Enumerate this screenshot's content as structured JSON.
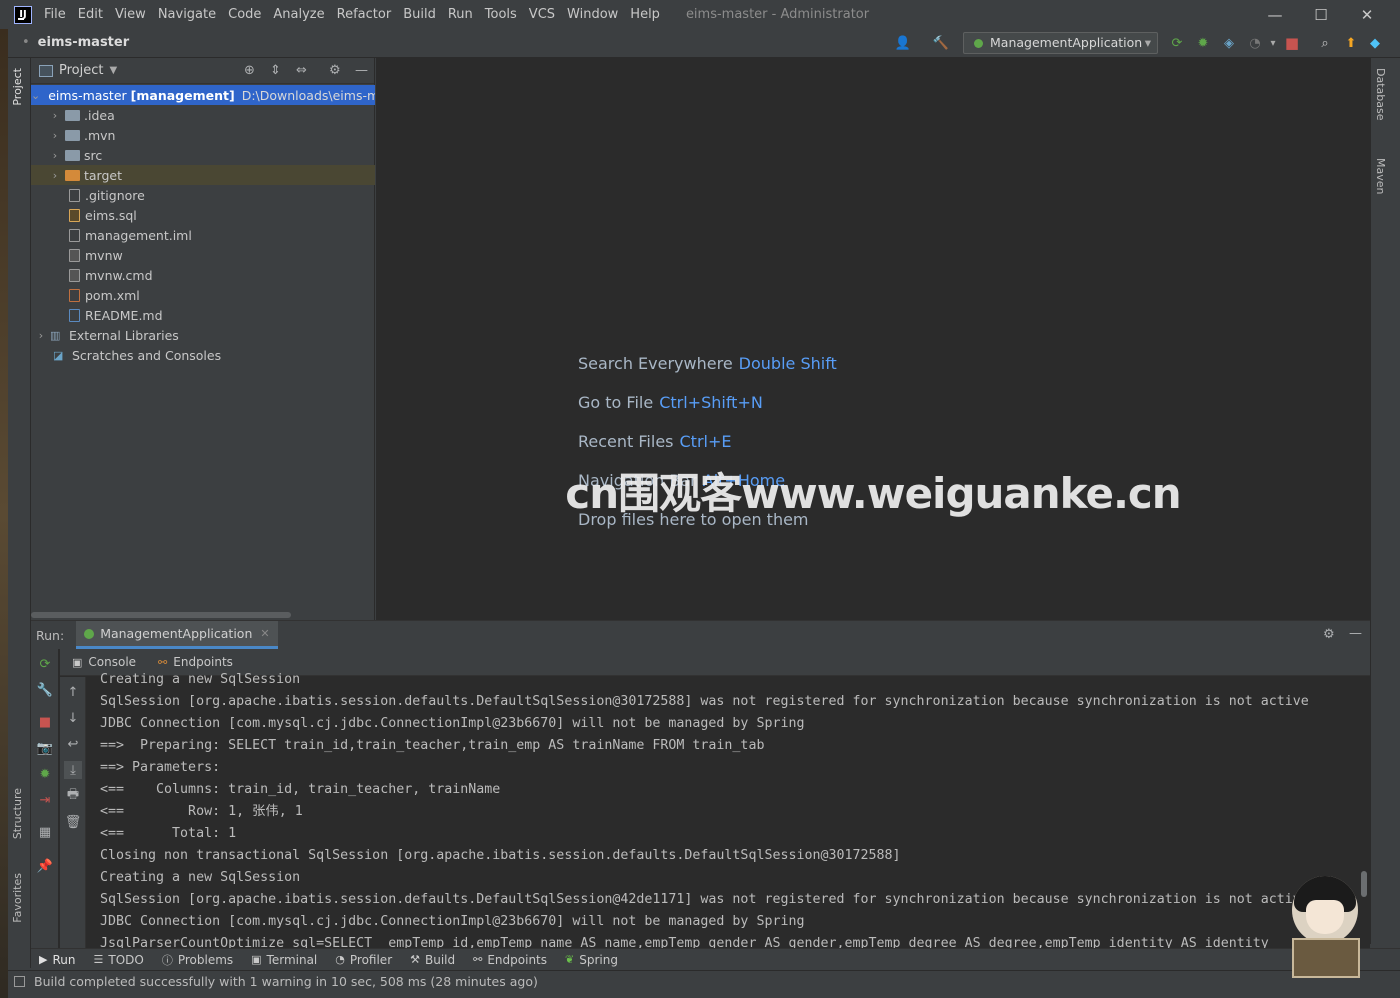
{
  "window": {
    "title": "eims-master - Administrator",
    "logo_text": "IJ",
    "minimize": "—",
    "maximize": "☐",
    "close": "✕"
  },
  "menu": [
    "File",
    "Edit",
    "View",
    "Navigate",
    "Code",
    "Analyze",
    "Refactor",
    "Build",
    "Run",
    "Tools",
    "VCS",
    "Window",
    "Help"
  ],
  "navbar": {
    "breadcrumb": "eims-master",
    "run_configuration": "ManagementApplication"
  },
  "left_strip": {
    "project_tab": "Project",
    "structure_tab": "Structure",
    "favorites_tab": "Favorites"
  },
  "right_strip": {
    "database_tab": "Database",
    "maven_tab": "Maven"
  },
  "project": {
    "title": "Project",
    "root": {
      "name": "eims-master",
      "module": "[management]",
      "path": "D:\\Downloads\\eims-m"
    },
    "items": [
      {
        "name": ".idea",
        "kind": "folder"
      },
      {
        "name": ".mvn",
        "kind": "folder"
      },
      {
        "name": "src",
        "kind": "folder"
      },
      {
        "name": "target",
        "kind": "folder-excluded"
      },
      {
        "name": ".gitignore",
        "kind": "file"
      },
      {
        "name": "eims.sql",
        "kind": "file"
      },
      {
        "name": "management.iml",
        "kind": "file"
      },
      {
        "name": "mvnw",
        "kind": "file"
      },
      {
        "name": "mvnw.cmd",
        "kind": "file"
      },
      {
        "name": "pom.xml",
        "kind": "file"
      },
      {
        "name": "README.md",
        "kind": "file"
      }
    ],
    "external_libraries": "External Libraries",
    "scratches": "Scratches and Consoles"
  },
  "editor": {
    "hints": [
      {
        "label": "Search Everywhere",
        "key": "Double Shift"
      },
      {
        "label": "Go to File",
        "key": "Ctrl+Shift+N"
      },
      {
        "label": "Recent Files",
        "key": "Ctrl+E"
      },
      {
        "label": "Navigation Bar",
        "key": "Alt+Home"
      },
      {
        "label": "Drop files here to open them",
        "key": ""
      }
    ],
    "watermark": "cn围观客www.weiguanke.cn"
  },
  "run": {
    "label": "Run:",
    "tab": "ManagementApplication",
    "console_tab": "Console",
    "endpoints_tab": "Endpoints",
    "lines": [
      "Creating a new SqlSession",
      "SqlSession [org.apache.ibatis.session.defaults.DefaultSqlSession@30172588] was not registered for synchronization because synchronization is not active",
      "JDBC Connection [com.mysql.cj.jdbc.ConnectionImpl@23b6670] will not be managed by Spring",
      "==>  Preparing: SELECT train_id,train_teacher,train_emp AS trainName FROM train_tab",
      "==> Parameters: ",
      "<==    Columns: train_id, train_teacher, trainName",
      "<==        Row: 1, 张伟, 1",
      "<==      Total: 1",
      "Closing non transactional SqlSession [org.apache.ibatis.session.defaults.DefaultSqlSession@30172588]",
      "Creating a new SqlSession",
      "SqlSession [org.apache.ibatis.session.defaults.DefaultSqlSession@42de1171] was not registered for synchronization because synchronization is not active",
      "JDBC Connection [com.mysql.cj.jdbc.ConnectionImpl@23b6670] will not be managed by Spring",
      "JsqlParserCountOptimize sql=SELECT  empTemp_id,empTemp_name AS name,empTemp_gender AS gender,empTemp_degree AS degree,empTemp_identity AS identity"
    ]
  },
  "bottom_tabs": [
    "Run",
    "TODO",
    "Problems",
    "Terminal",
    "Profiler",
    "Build",
    "Endpoints",
    "Spring"
  ],
  "status": "Build completed successfully with 1 warning in 10 sec, 508 ms (28 minutes ago)",
  "colors": {
    "accent": "#589df6",
    "selection": "#2f65ca",
    "run_green": "#5fa74a",
    "stop_red": "#c75450"
  }
}
